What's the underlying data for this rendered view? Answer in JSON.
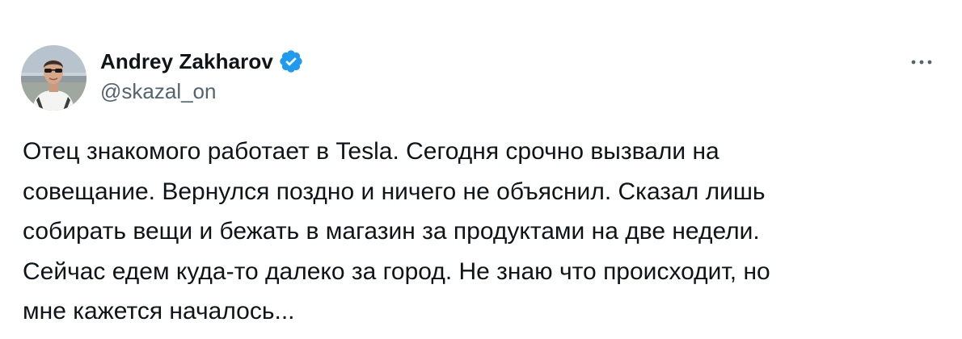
{
  "author": {
    "display_name": "Andrey Zakharov",
    "handle": "@skazal_on",
    "verified": true,
    "avatar_icon": "profile-photo",
    "verified_icon": "verified-badge-icon",
    "verified_color": "#1d9bf0"
  },
  "menu": {
    "icon": "more-horizontal-icon"
  },
  "tweet": {
    "lines": [
      "Отец знакомого работает в Tesla. Сегодня срочно вызвали на",
      "совещание. Вернулся поздно и ничего не объяснил. Сказал лишь",
      "собирать вещи и бежать в магазин за продуктами на две недели.",
      "Сейчас едем куда-то далеко за город. Не знаю что происходит, но",
      "мне кажется началось..."
    ]
  },
  "colors": {
    "text": "#0f1419",
    "secondary": "#536471",
    "background": "#ffffff"
  }
}
